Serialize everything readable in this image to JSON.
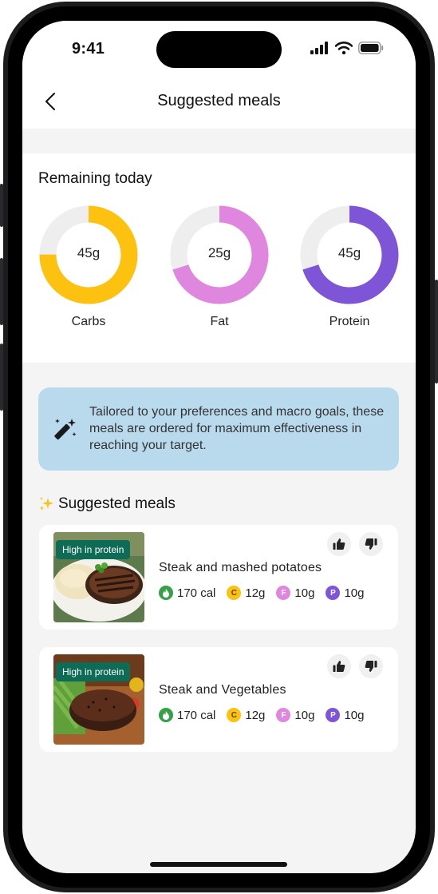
{
  "status_bar": {
    "time": "9:41"
  },
  "nav": {
    "title": "Suggested meals"
  },
  "remaining": {
    "title": "Remaining today",
    "rings": [
      {
        "label": "Carbs",
        "value": "45g",
        "fraction": 0.75,
        "color": "#fdc20f"
      },
      {
        "label": "Fat",
        "value": "25g",
        "fraction": 0.7,
        "color": "#df86df"
      },
      {
        "label": "Protein",
        "value": "45g",
        "fraction": 0.7,
        "color": "#7f55d8"
      }
    ]
  },
  "info": {
    "text": "Tailored to your preferences and macro goals, these meals are ordered for maximum effectiveness in reaching your target."
  },
  "suggested": {
    "title": "Suggested meals",
    "meals": [
      {
        "tag": "High in protein",
        "name": "Steak and mashed potatoes",
        "cal": "170 cal",
        "carbs": "12g",
        "fat": "10g",
        "protein": "10g"
      },
      {
        "tag": "High in protein",
        "name": "Steak and Vegetables",
        "cal": "170 cal",
        "carbs": "12g",
        "fat": "10g",
        "protein": "10g"
      }
    ]
  },
  "colors": {
    "accent_green": "#0e6b55",
    "cal": "#35a047",
    "carbs": "#fdc20f",
    "fat": "#df86df",
    "protein": "#7f55d8",
    "info_bg": "#b9d9ec"
  }
}
